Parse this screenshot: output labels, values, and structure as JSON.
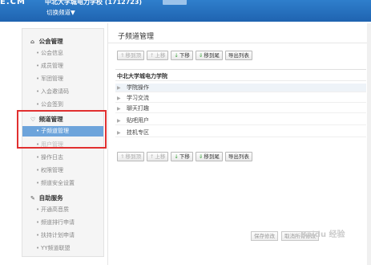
{
  "header": {
    "logo": "E.CM",
    "channel_title": "中北大学城电力学校 (1712723)",
    "switch_channel": "切换频道▼"
  },
  "sidebar": {
    "sections": [
      {
        "label": "公会管理",
        "icon": "home-icon",
        "items": [
          "公会信息",
          "成员管理",
          "军团管理",
          "入会邀请码",
          "公会签到"
        ]
      },
      {
        "label": "频道管理",
        "icon": "channel-icon",
        "items": [
          "子频道管理",
          "用户管理",
          "操作日志",
          "权限管理",
          "频道安全设置"
        ]
      },
      {
        "label": "自助服务",
        "icon": "wrench-icon",
        "items": [
          "开通高音质",
          "频道排行申请",
          "扶持计划申请",
          "YY频道联盟"
        ]
      }
    ],
    "active_item": "子频道管理"
  },
  "main": {
    "title": "子频道管理",
    "toolbar": {
      "move_top": "移到顶",
      "move_up": "上移",
      "move_down": "下移",
      "move_bottom": "移到尾",
      "export": "导出列表"
    },
    "list_header": "中北大学城电力学院",
    "rows": [
      "学院操作",
      "学习交流",
      "聊天打趣",
      "贴吧用户",
      "挂机专区"
    ],
    "save_button": "保存修改",
    "cancel_button": "取消所有修改"
  },
  "watermark": "Baidu 经验",
  "colors": {
    "header_blue": "#2470bd",
    "sidebar_active": "#6da4db",
    "highlight_red": "#e13030",
    "arrow_green": "#3aa23a"
  }
}
